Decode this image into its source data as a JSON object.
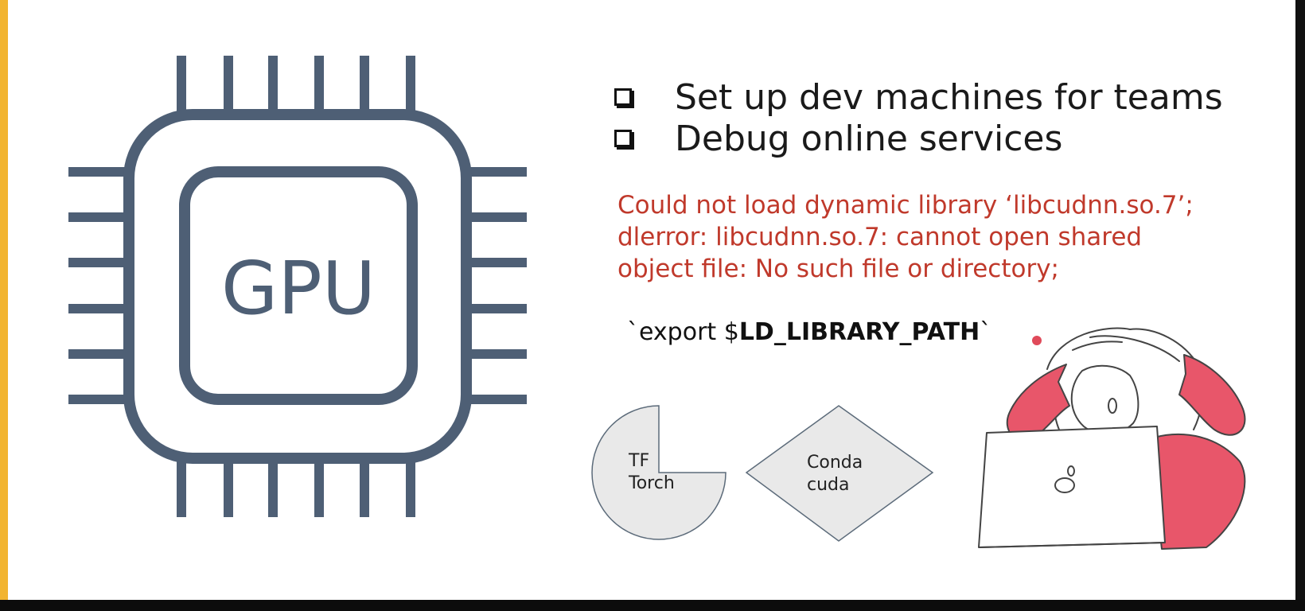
{
  "gpu": {
    "chip_label": "GPU"
  },
  "bullets": [
    {
      "text": "Set up dev machines for teams"
    },
    {
      "text": "Debug online services"
    }
  ],
  "error": {
    "lines": [
      "Could not load dynamic library ‘libcudnn.so.7’;",
      "dlerror: libcudnn.so.7: cannot open shared",
      "object file: No such file or directory;"
    ],
    "color": "#c0392b"
  },
  "export_cmd": {
    "prefix": "`export $",
    "variable": "LD_LIBRARY_PATH",
    "suffix": "`"
  },
  "shapes": {
    "pie": {
      "line1": "TF",
      "line2": "Torch"
    },
    "diamond": {
      "line1": "Conda",
      "line2": "cuda"
    }
  },
  "colors": {
    "chip": "#4e5f75",
    "accent_yellow": "#f2b430",
    "illustration_red": "#e8566a"
  }
}
